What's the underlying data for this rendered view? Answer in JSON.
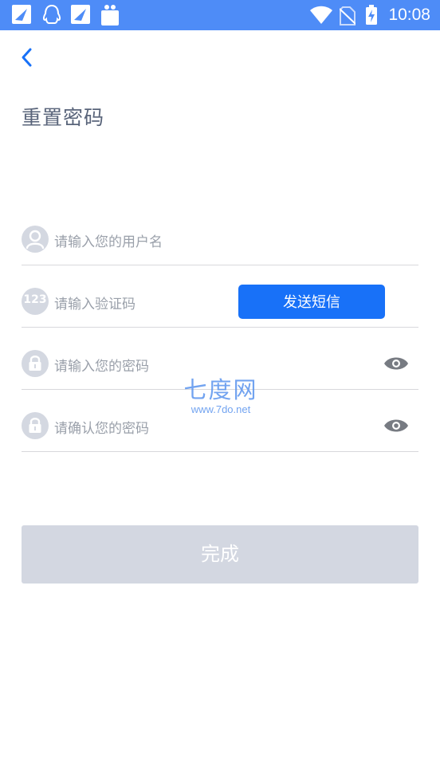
{
  "status_bar": {
    "time": "10:08",
    "left_icons": [
      "notification-app-icon",
      "qq-icon",
      "notification-app-icon",
      "shopping-bag-icon"
    ],
    "right_icons": [
      "wifi-icon",
      "no-sim-icon",
      "battery-charging-icon"
    ]
  },
  "header": {
    "back_icon": "chevron-left-icon",
    "title": "重置密码"
  },
  "form": {
    "username_placeholder": "请输入您的用户名",
    "code_placeholder": "请输入验证码",
    "code_icon_text": "123",
    "send_sms_label": "发送短信",
    "password_placeholder": "请输入您的密码",
    "confirm_placeholder": "请确认您的密码"
  },
  "watermark": {
    "title": "七度网",
    "url": "www.7do.net"
  },
  "submit": {
    "label": "完成"
  },
  "colors": {
    "status_bar": "#4e8cf7",
    "accent": "#1871f8",
    "disabled_button": "#d3d7e1",
    "icon_gray": "#d4d8e1"
  }
}
